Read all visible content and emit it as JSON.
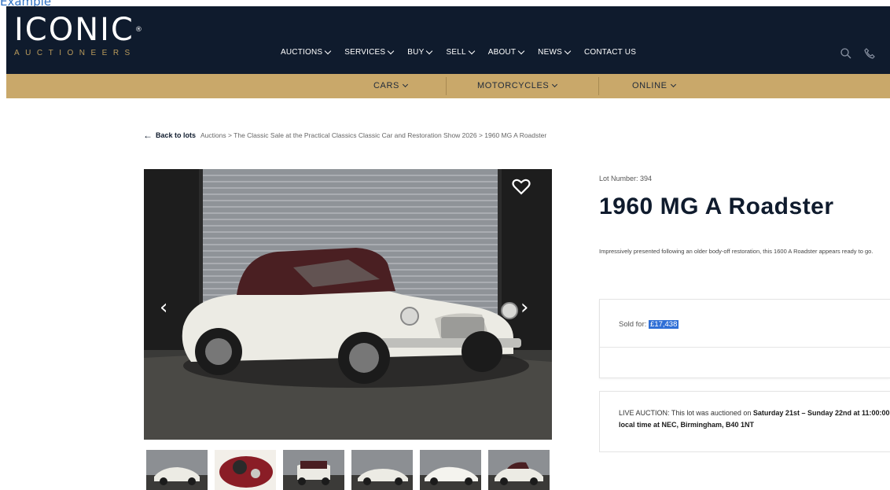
{
  "page_label": "Example",
  "header": {
    "logo_main": "ICONIC",
    "logo_reg": "®",
    "logo_sub": "AUCTIONEERS",
    "menu": [
      {
        "label": "AUCTIONS"
      },
      {
        "label": "SERVICES"
      },
      {
        "label": "BUY"
      },
      {
        "label": "SELL"
      },
      {
        "label": "ABOUT"
      },
      {
        "label": "NEWS"
      },
      {
        "label": "CONTACT US"
      }
    ],
    "icons": [
      "search-icon",
      "phone-icon"
    ]
  },
  "subnav": [
    {
      "label": "CARS"
    },
    {
      "label": "MOTORCYCLES"
    },
    {
      "label": "ONLINE"
    }
  ],
  "breadcrumb": {
    "back": "Back to lots",
    "path": "Auctions > The Classic Sale at the Practical Classics Classic Car and Restoration Show 2026 > 1960 MG A Roadster"
  },
  "lot": {
    "number_label": "Lot Number: 394",
    "title": "1960 MG A Roadster",
    "description": "Impressively presented following an older body-off restoration, this 1600 A Roadster appears ready to go.",
    "sold_label": "Sold for: ",
    "sold_price": "£17,438",
    "live_prefix": "LIVE AUCTION: This lot was auctioned on ",
    "live_dates": "Saturday 21st – Sunday 22nd at 11:00:00 local time at NEC, Birmingham, B40 1NT"
  },
  "gallery": {
    "thumbnail_count": 6
  },
  "colors": {
    "nav_bg": "#0f1b2d",
    "gold": "#c9a86a",
    "highlight": "#2f6fd6"
  }
}
